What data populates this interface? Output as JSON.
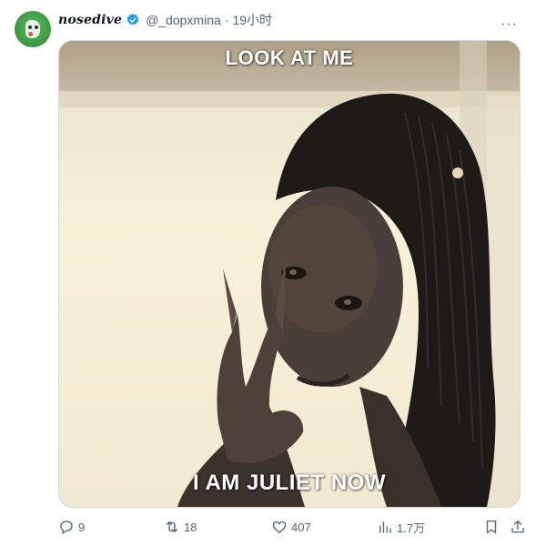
{
  "tweet": {
    "display_name": "nosedive",
    "handle": "@_dopxmina",
    "separator": "·",
    "time": "19小时",
    "more_label": "···"
  },
  "media": {
    "caption_top": "LOOK AT ME",
    "caption_bottom": "I AM JULIET NOW"
  },
  "actions": {
    "replies": "9",
    "retweets": "18",
    "likes": "407",
    "views": "1.7万"
  },
  "colors": {
    "verified": "#1d9bf0",
    "text_secondary": "#536471",
    "border": "#cfd9de"
  },
  "icons": [
    "verified-badge-icon",
    "more-icon",
    "reply-icon",
    "retweet-icon",
    "like-icon",
    "views-icon",
    "bookmark-icon",
    "share-icon"
  ]
}
